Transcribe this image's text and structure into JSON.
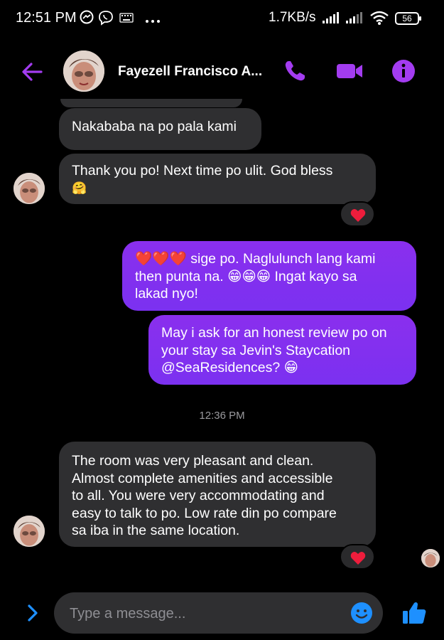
{
  "status_bar": {
    "time": "12:51 PM",
    "net_speed": "1.7KB/s",
    "battery": "56"
  },
  "header": {
    "contact_name": "Fayezell Francisco A...",
    "icons": [
      "back-arrow-icon",
      "phone-icon",
      "video-call-icon",
      "info-icon"
    ],
    "accent_color": "#a33cf0"
  },
  "messages": [
    {
      "id": "m1",
      "direction": "incoming",
      "text": "Nakababa na po pala kami"
    },
    {
      "id": "m2",
      "direction": "incoming",
      "text": "Thank you po! Next time po ulit. God bless",
      "emoji": "🤗",
      "reaction": "❤️"
    },
    {
      "id": "m3",
      "direction": "outgoing",
      "lines": [
        "❤️❤️❤️ sige po. Naglulunch lang kami",
        "then punta na. 😁😁😁 Ingat kayo sa",
        "lakad nyo!"
      ]
    },
    {
      "id": "m4",
      "direction": "outgoing",
      "lines": [
        "May i ask for an honest review po on",
        "your stay sa Jevin's Staycation",
        "@SeaResidences? 😁"
      ]
    },
    {
      "id": "m5",
      "direction": "incoming",
      "lines": [
        "The room was very pleasant and clean.",
        "Almost complete amenities and accessible",
        "to all. You were very accommodating and",
        "easy to talk to po. Low rate din po compare",
        "sa iba in the same location."
      ],
      "reaction": "❤️"
    }
  ],
  "timestamp": "12:36 PM",
  "composer": {
    "placeholder": "Type a message..."
  },
  "colors": {
    "outgoing_bubble": "#8a2fee",
    "incoming_bubble": "#2f2f31",
    "icon_accent": "#a33cf0",
    "send_accent": "#1e90ff"
  }
}
